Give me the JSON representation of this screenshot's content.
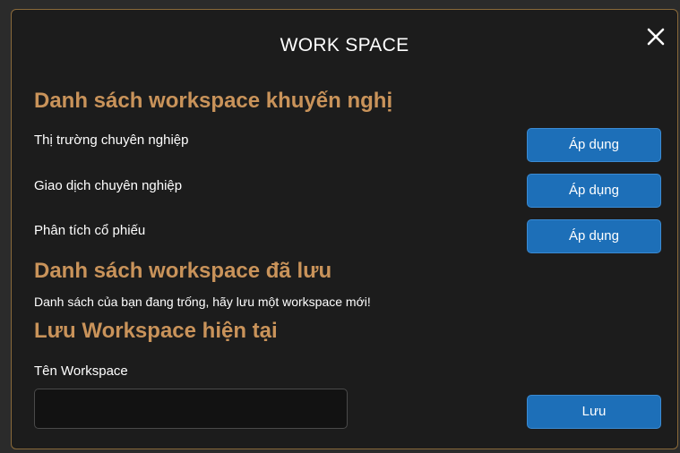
{
  "modal": {
    "title": "WORK SPACE",
    "close_icon": "close-icon"
  },
  "recommended": {
    "heading": "Danh sách workspace khuyến nghị",
    "items": [
      {
        "label": "Thị trường chuyên nghiệp",
        "button": "Áp dụng"
      },
      {
        "label": "Giao dịch chuyên nghiệp",
        "button": "Áp dụng"
      },
      {
        "label": "Phân tích cổ phiếu",
        "button": "Áp dụng"
      }
    ]
  },
  "saved": {
    "heading": "Danh sách workspace đã lưu",
    "empty_message": "Danh sách của bạn đang trống, hãy lưu một workspace mới!"
  },
  "save_current": {
    "heading": "Lưu Workspace hiện tại",
    "field_label": "Tên Workspace",
    "input_value": "",
    "input_placeholder": "",
    "save_button": "Lưu"
  },
  "colors": {
    "accent_heading": "#c9935a",
    "button_blue": "#1d6fb8",
    "modal_bg": "#1c1c1c"
  }
}
